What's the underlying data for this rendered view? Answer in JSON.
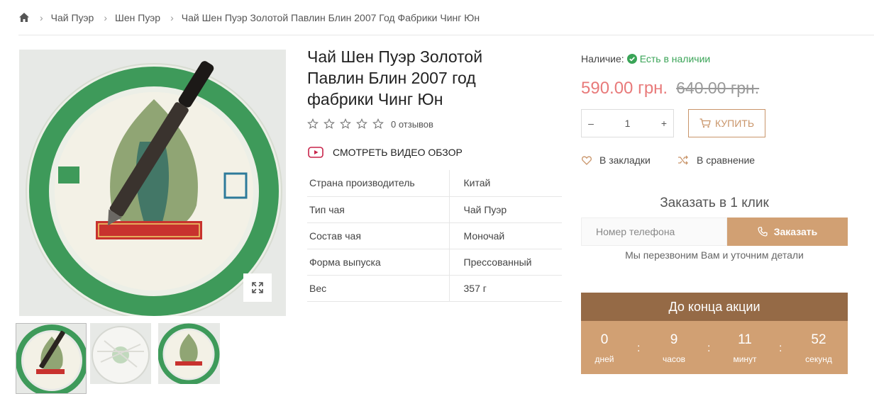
{
  "breadcrumb": {
    "home_icon": "home-icon",
    "items": [
      "Чай Пуэр",
      "Шен Пуэр",
      "Чай Шен Пуэр Золотой Павлин Блин 2007 Год Фабрики Чинг Юн"
    ]
  },
  "product": {
    "title": "Чай Шен Пуэр Золотой Павлин Блин 2007 год фабрики Чинг Юн",
    "rating": {
      "stars": 0,
      "max": 5,
      "reviews_label": "0 отзывов"
    },
    "video_label": "СМОТРЕТЬ ВИДЕО ОБЗОР",
    "specs": [
      {
        "key": "Страна производитель",
        "value": "Китай"
      },
      {
        "key": "Тип чая",
        "value": "Чай Пуэр"
      },
      {
        "key": "Состав чая",
        "value": "Моночай"
      },
      {
        "key": "Форма выпуска",
        "value": "Прессованный"
      },
      {
        "key": "Вес",
        "value": "357 г"
      }
    ]
  },
  "purchase": {
    "stock_label": "Наличие:",
    "stock_status": "Есть в наличии",
    "price_new": "590.00 грн.",
    "price_old": "640.00 грн.",
    "qty_minus": "–",
    "qty_value": "1",
    "qty_plus": "+",
    "buy_label": "КУПИТЬ",
    "wishlist_label": "В закладки",
    "compare_label": "В сравнение"
  },
  "one_click": {
    "title": "Заказать в 1 клик",
    "phone_placeholder": "Номер телефона",
    "button_label": "Заказать",
    "note": "Мы перезвоним Вам и уточним детали"
  },
  "countdown": {
    "title": "До конца акции",
    "units": [
      {
        "value": "0",
        "label": "дней"
      },
      {
        "value": "9",
        "label": "часов"
      },
      {
        "value": "11",
        "label": "минут"
      },
      {
        "value": "52",
        "label": "секунд"
      }
    ]
  },
  "colors": {
    "accent": "#d1a073",
    "accent_dark": "#956a46",
    "price": "#e87a7a",
    "stock": "#3aa457"
  }
}
